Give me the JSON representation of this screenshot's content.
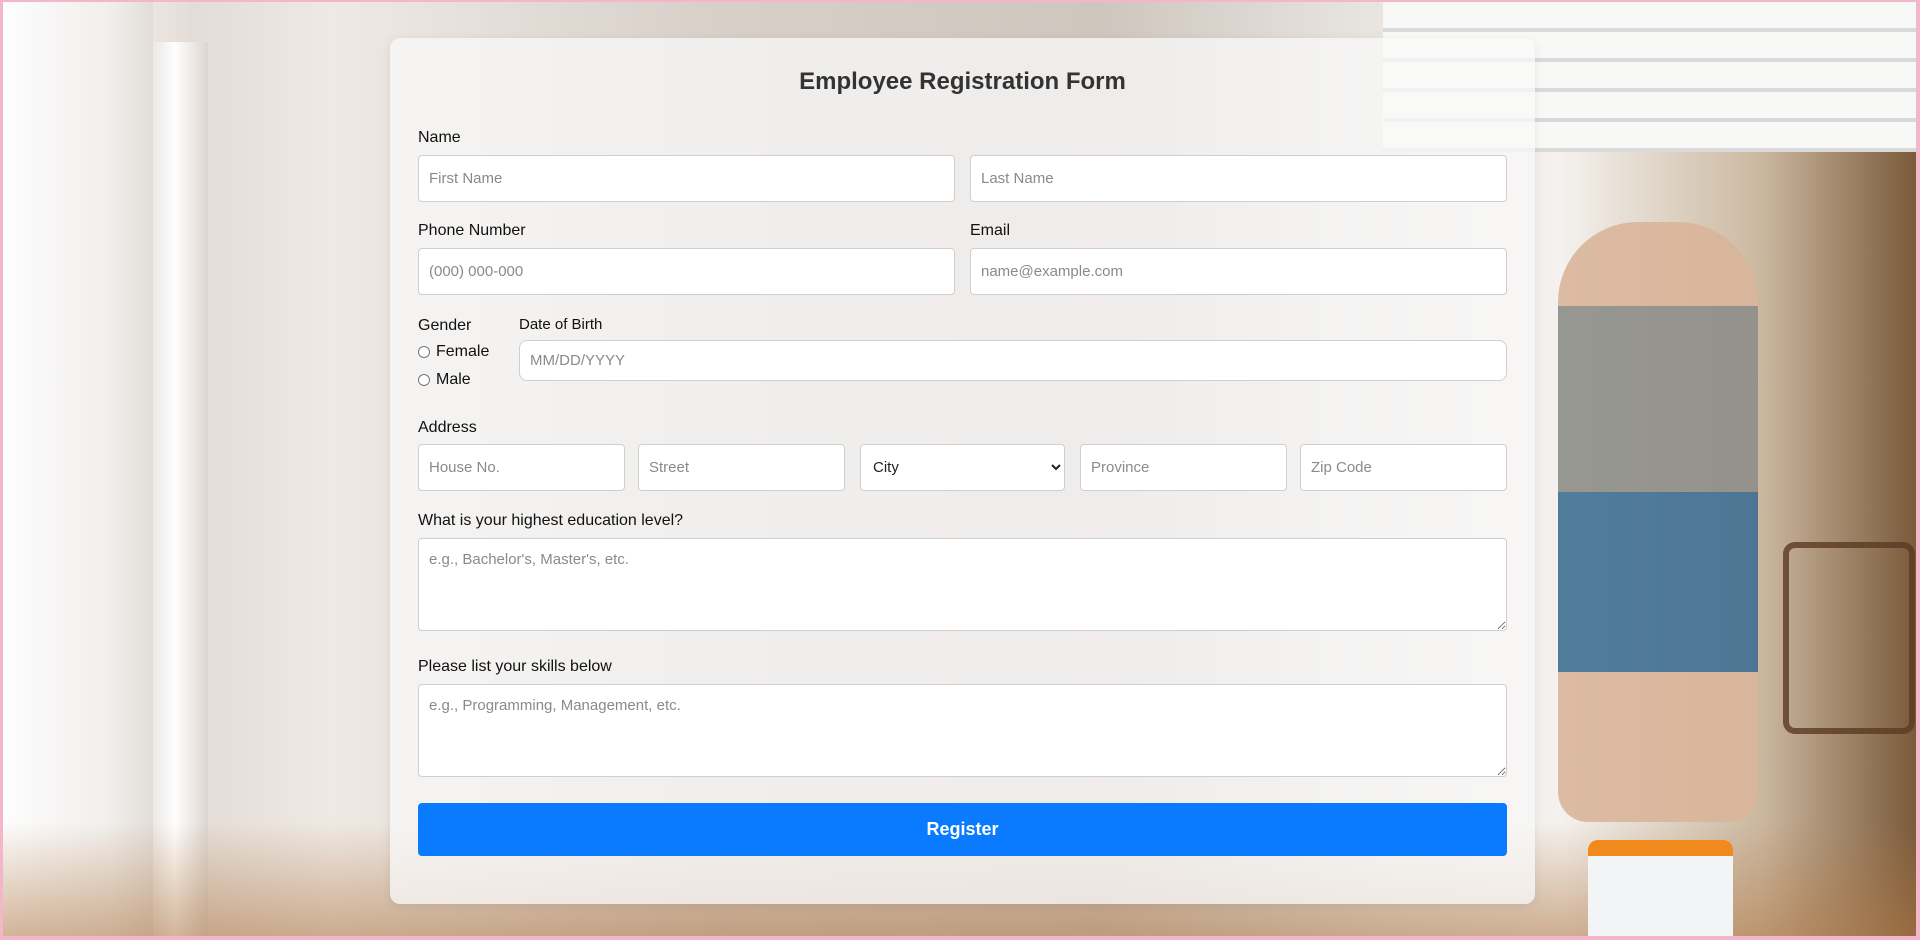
{
  "form": {
    "title": "Employee Registration Form",
    "name_label": "Name",
    "first_name_placeholder": "First Name",
    "last_name_placeholder": "Last Name",
    "phone_label": "Phone Number",
    "phone_placeholder": "(000) 000-000",
    "email_label": "Email",
    "email_placeholder": "name@example.com",
    "gender_label": "Gender",
    "gender_options": [
      "Female",
      "Male"
    ],
    "dob_label": "Date of Birth",
    "dob_placeholder": "MM/DD/YYYY",
    "address_label": "Address",
    "house_placeholder": "House No.",
    "street_placeholder": "Street",
    "city_selected": "City",
    "province_placeholder": "Province",
    "zip_placeholder": "Zip Code",
    "education_label": "What is your highest education level?",
    "education_placeholder": "e.g., Bachelor's, Master's, etc.",
    "skills_label": "Please list your skills below",
    "skills_placeholder": "e.g., Programming, Management, etc.",
    "submit_label": "Register"
  },
  "colors": {
    "accent": "#0a7bff",
    "page_border": "#f4b6cb"
  }
}
